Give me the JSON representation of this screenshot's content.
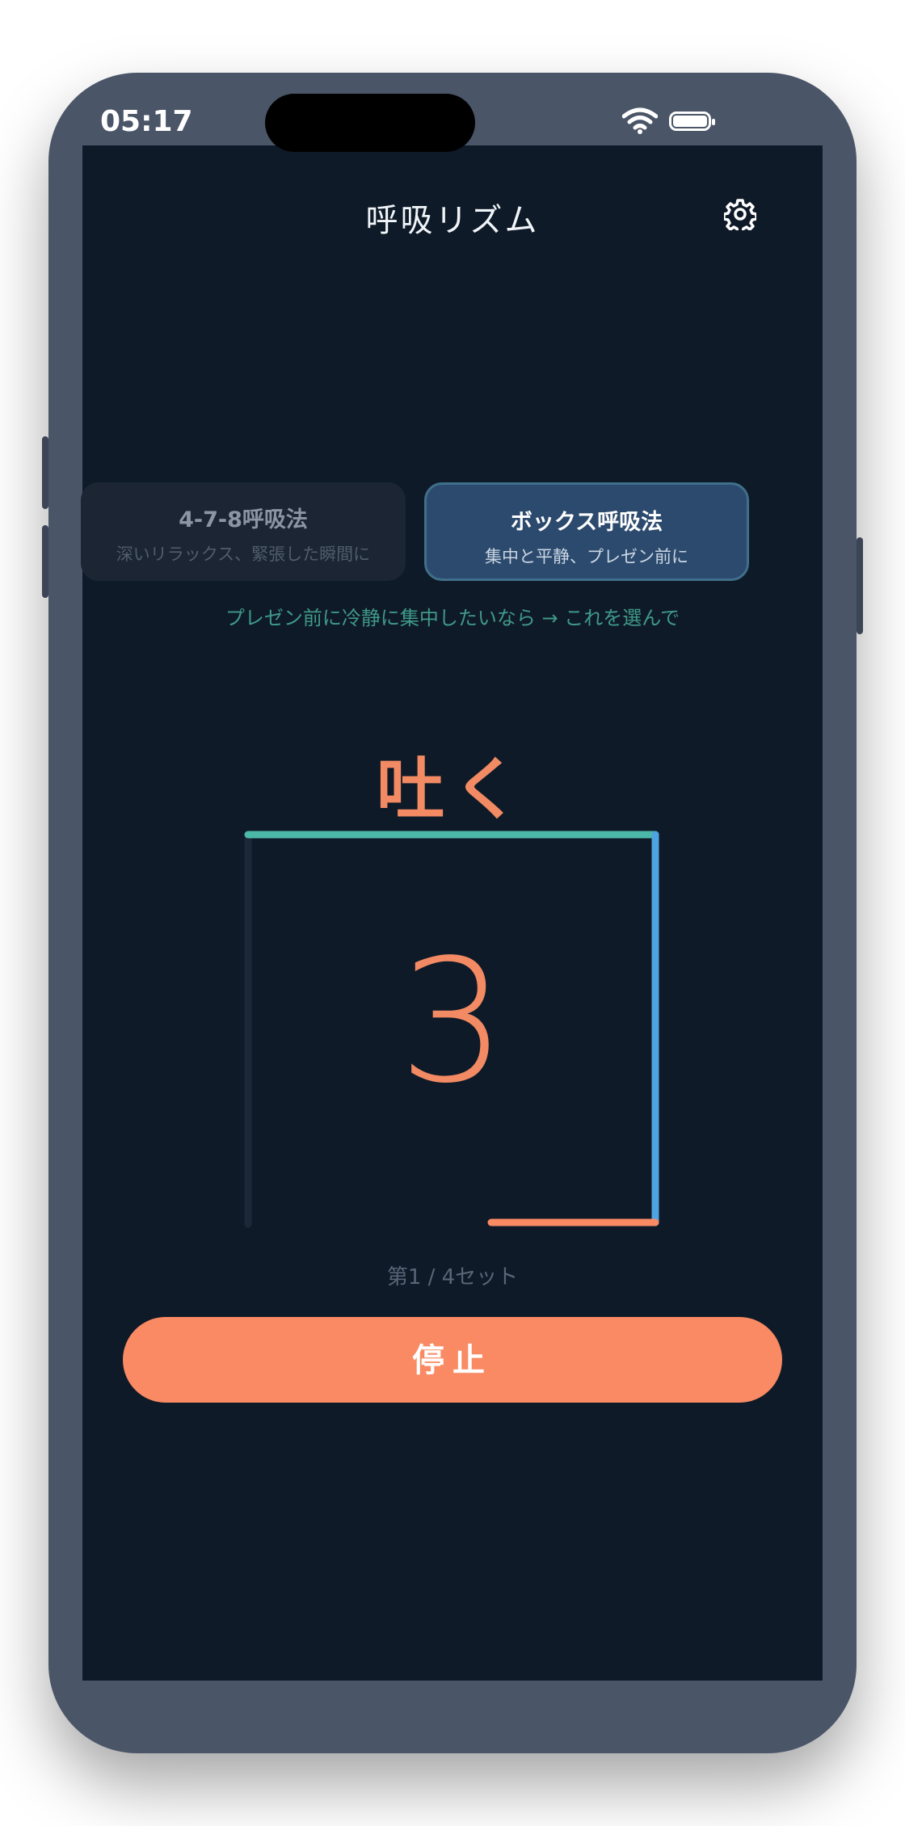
{
  "status_bar": {
    "time": "05:17"
  },
  "header": {
    "title": "呼吸リズム"
  },
  "modes": [
    {
      "title": "4-7-8呼吸法",
      "subtitle": "深いリラックス、緊張した瞬間に",
      "selected": false
    },
    {
      "title": "ボックス呼吸法",
      "subtitle": "集中と平静、プレゼン前に",
      "selected": true
    }
  ],
  "hint": "プレゼン前に冷静に集中したいなら → これを選んで",
  "session": {
    "phase": "吐く",
    "count": "3",
    "sets_label": "第1 / 4セット"
  },
  "stop_button": {
    "label": "停止"
  },
  "colors": {
    "accent": "#f98a63",
    "teal": "#4cb8a8",
    "blue": "#4ea3e0",
    "background": "#0f1a28"
  },
  "icons": [
    "settings-gear-icon",
    "wifi-icon",
    "battery-icon",
    "signal-icon"
  ]
}
